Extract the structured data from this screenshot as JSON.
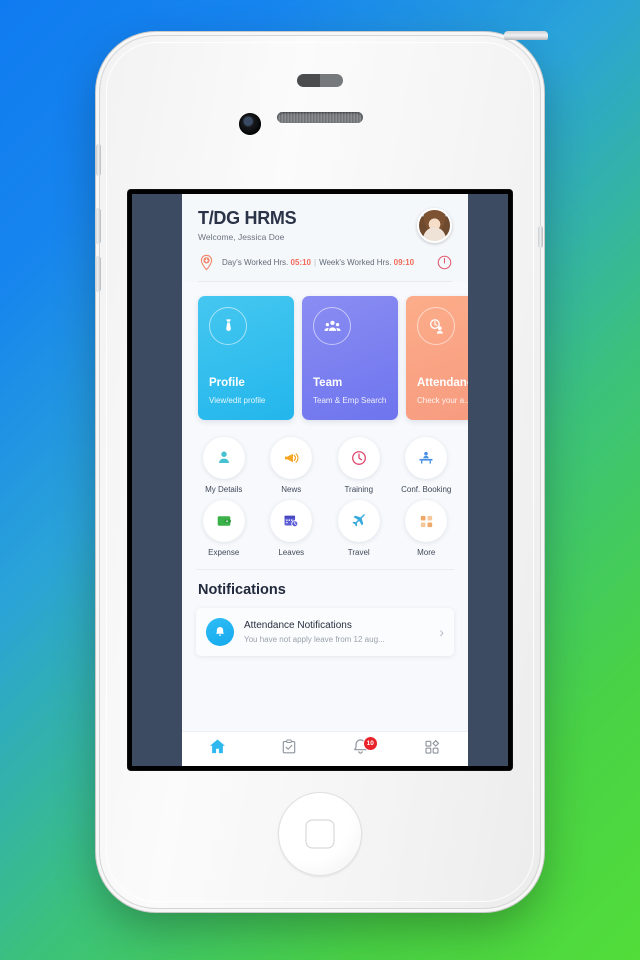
{
  "app": {
    "title": "T/DG HRMS",
    "welcome": "Welcome, Jessica Doe",
    "stats": {
      "day_label": "Day's Worked Hrs.",
      "day_value": "05:10",
      "separator": "|",
      "week_label": "Week's Worked Hrs.",
      "week_value": "09:10"
    },
    "icons": {
      "pin": "location-pin-icon",
      "power": "power-icon",
      "avatar": "user-avatar"
    }
  },
  "cards": [
    {
      "title": "Profile",
      "subtitle": "View/edit profile",
      "icon": "necktie-icon",
      "color": "#23b6ec"
    },
    {
      "title": "Team",
      "subtitle": "Team & Emp Search",
      "icon": "people-icon",
      "color": "#6e74ee"
    },
    {
      "title": "Attendance",
      "subtitle": "Check your a...",
      "icon": "attendance-clock-icon",
      "color": "#f79a7f"
    }
  ],
  "grid": [
    {
      "label": "My Details",
      "icon": "person-icon",
      "color": "#45c2d1"
    },
    {
      "label": "News",
      "icon": "megaphone-icon",
      "color": "#f5a623"
    },
    {
      "label": "Training",
      "icon": "clock-icon",
      "color": "#e0456b"
    },
    {
      "label": "Conf. Booking",
      "icon": "desk-icon",
      "color": "#4a90e2"
    },
    {
      "label": "Expense",
      "icon": "wallet-icon",
      "color": "#3bb14a"
    },
    {
      "label": "Leaves",
      "icon": "calendar-icon",
      "color": "#5b5bd6"
    },
    {
      "label": "Travel",
      "icon": "airplane-icon",
      "color": "#38a9dd"
    },
    {
      "label": "More",
      "icon": "grid-icon",
      "color": "#f0a868"
    }
  ],
  "notifications": {
    "heading": "Notifications",
    "items": [
      {
        "title": "Attendance Notifications",
        "subtitle": "You have not apply leave from 12 aug...",
        "icon": "bell-icon",
        "chevron": "›"
      }
    ]
  },
  "bottom_nav": [
    {
      "icon": "home-icon",
      "active": true,
      "badge": ""
    },
    {
      "icon": "checklist-icon",
      "active": false,
      "badge": ""
    },
    {
      "icon": "bell-icon",
      "active": false,
      "badge": "10"
    },
    {
      "icon": "apps-grid-icon",
      "active": false,
      "badge": ""
    }
  ],
  "theme": {
    "background_start": "#0f7bf0",
    "background_end": "#52dd3a",
    "screen_sidebar": "#3c4b61",
    "accent_red": "#f26b5a",
    "active_blue": "#2fb8f0"
  }
}
